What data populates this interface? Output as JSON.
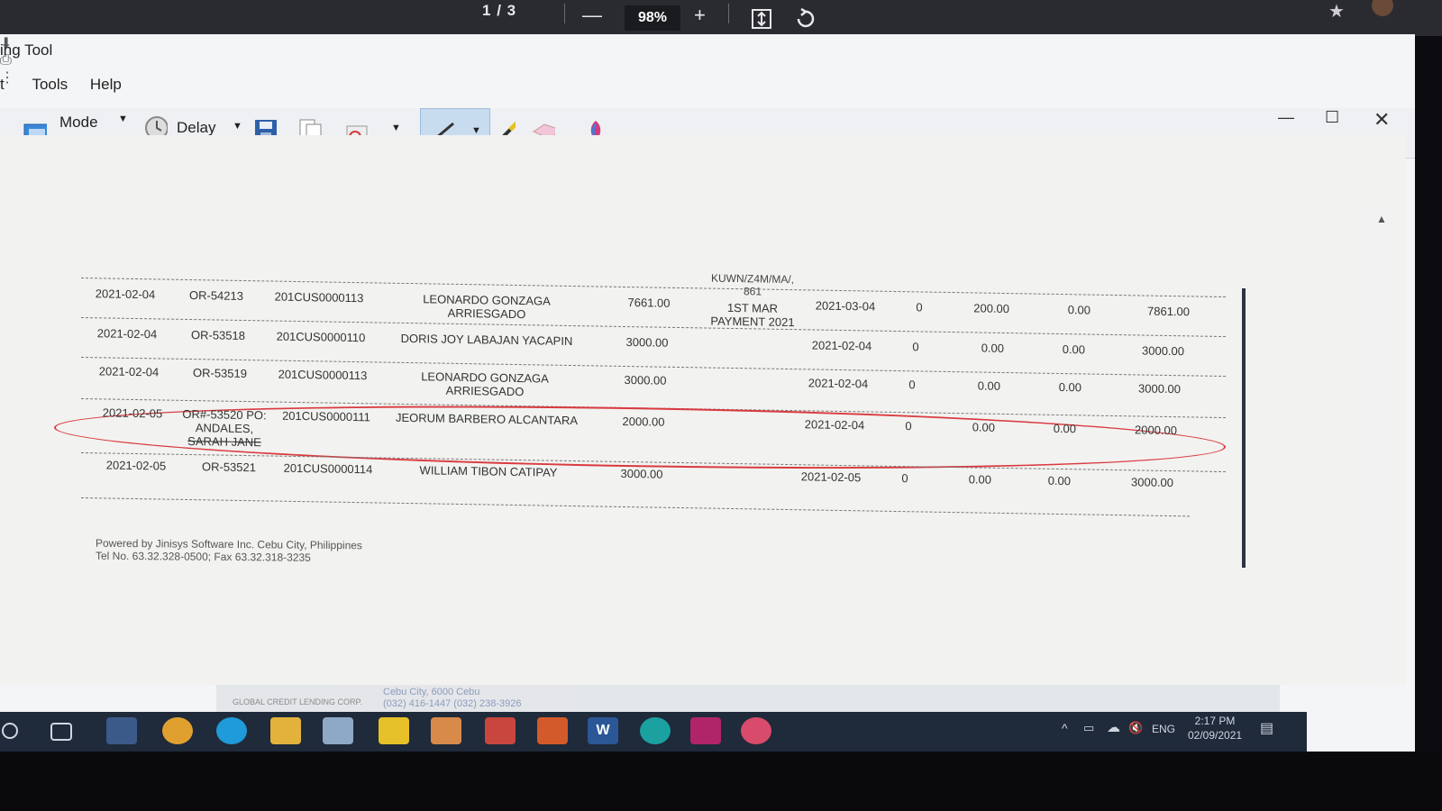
{
  "pdf_viewer": {
    "page_current": "1",
    "page_separator": "/",
    "page_total": "3",
    "zoom": "98%"
  },
  "snip_window": {
    "title": "ing Tool",
    "menu": [
      "t",
      "Tools",
      "Help"
    ],
    "toolbar": {
      "mode_label": "Mode",
      "delay_label": "Delay"
    }
  },
  "report": {
    "header_fragment": [
      "KUWN/Z4M/MA/,",
      "861"
    ],
    "rows": [
      {
        "date": "2021-02-04",
        "or": "OR-54213",
        "customer": "201CUS0000113",
        "name": [
          "LEONARDO GONZAGA",
          "ARRIESGADO"
        ],
        "amount": "7661.00",
        "remarks": [
          "1ST MAR",
          "PAYMENT 2021"
        ],
        "due": "2021-03-04",
        "c1": "0",
        "c2": "200.00",
        "c3": "0.00",
        "total": "7861.00"
      },
      {
        "date": "2021-02-04",
        "or": "OR-53518",
        "customer": "201CUS0000110",
        "name": [
          "DORIS JOY LABAJAN YACAPIN",
          ""
        ],
        "amount": "3000.00",
        "remarks": [
          "",
          ""
        ],
        "due": "2021-02-04",
        "c1": "0",
        "c2": "0.00",
        "c3": "0.00",
        "total": "3000.00"
      },
      {
        "date": "2021-02-04",
        "or": "OR-53519",
        "customer": "201CUS0000113",
        "name": [
          "LEONARDO GONZAGA",
          "ARRIESGADO"
        ],
        "amount": "3000.00",
        "remarks": [
          "",
          ""
        ],
        "due": "2021-02-04",
        "c1": "0",
        "c2": "0.00",
        "c3": "0.00",
        "total": "3000.00"
      },
      {
        "date": "2021-02-05",
        "or": "OR#-53520 PO:",
        "or_extra": [
          "ANDALES,",
          "SARAH JANE"
        ],
        "customer": "201CUS0000111",
        "name": [
          "JEORUM BARBERO ALCANTARA",
          ""
        ],
        "amount": "2000.00",
        "remarks": [
          "",
          ""
        ],
        "due": "2021-02-04",
        "c1": "0",
        "c2": "0.00",
        "c3": "0.00",
        "total": "2000.00"
      },
      {
        "date": "2021-02-05",
        "or": "OR-53521",
        "customer": "201CUS0000114",
        "name": [
          "WILLIAM TIBON CATIPAY",
          ""
        ],
        "amount": "3000.00",
        "remarks": [
          "",
          ""
        ],
        "due": "2021-02-05",
        "c1": "0",
        "c2": "0.00",
        "c3": "0.00",
        "total": "3000.00"
      }
    ],
    "footer": [
      "Powered by Jinisys Software Inc. Cebu City, Philippines",
      "Tel No. 63.32.328-0500; Fax 63.32.318-3235"
    ]
  },
  "background_window": {
    "company": "GLOBAL CREDIT LENDING CORP.",
    "address": "Cebu City, 6000 Cebu",
    "phones": "(032) 416-1447 (032) 238-3926"
  },
  "system_tray": {
    "language": "ENG",
    "time": "2:17 PM",
    "date": "02/09/2021"
  },
  "colors": {
    "highlight_oval": "#d93a3f",
    "pdf_bar": "#2a2b30",
    "taskbar": "#1f2a3a"
  }
}
